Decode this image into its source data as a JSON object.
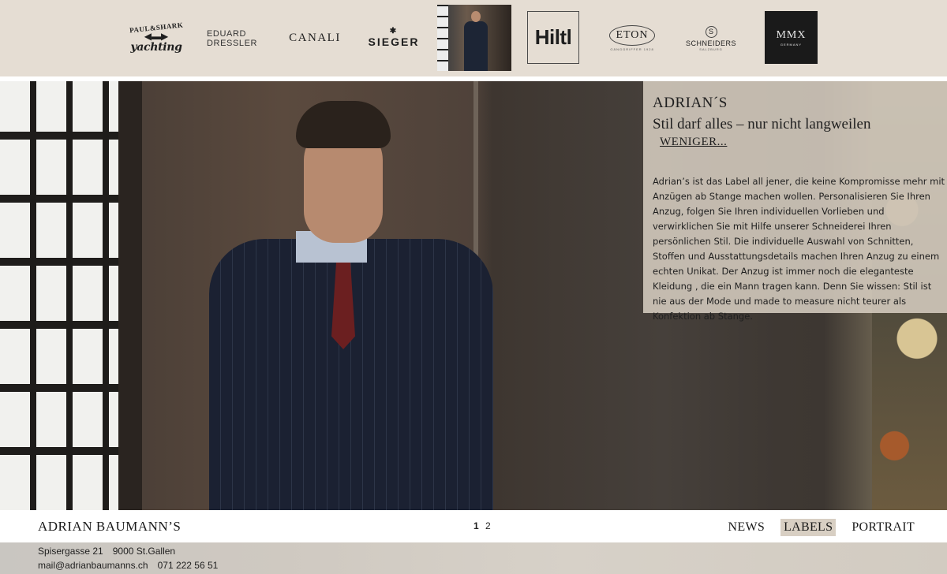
{
  "brands": {
    "paul_shark": {
      "top": "PAUL&SHARK",
      "bottom": "yachting"
    },
    "eduard_dressler": {
      "line1": "EDUARD",
      "line2": "DRESSLER"
    },
    "canali": "CANALI",
    "sieger": "SIEGER",
    "hiltl": "Hiltl",
    "eton": {
      "name": "ETON",
      "sub": "GÄNGGRIFFER 1928"
    },
    "schneiders": {
      "name": "SCHNEIDERS",
      "sub": "SALZBURG"
    },
    "mmx": {
      "name": "MMX",
      "sub": "GERMANY"
    }
  },
  "info": {
    "title": "ADRIAN´S",
    "tagline": "Stil darf alles – nur nicht langweilen",
    "toggle_label": "WENIGER...",
    "body": "Adrian’s ist das Label all jener, die keine Kompromisse mehr mit Anzügen ab Stange machen wollen. Personalisieren Sie Ihren Anzug, folgen Sie Ihren individuellen Vorlieben und verwirklichen Sie mit Hilfe unserer Schneiderei Ihren persönlichen Stil. Die individuelle Auswahl von Schnitten, Stoffen und Ausstattungsdetails machen Ihren Anzug zu einem echten Unikat. Der Anzug ist immer noch die eleganteste Kleidung , die ein Mann tragen kann. Denn Sie wissen: Stil ist nie aus der Mode und made to measure nicht teurer als Konfektion ab Stange."
  },
  "footer": {
    "logo": "ADRIAN BAUMANN’S",
    "pages": [
      "1",
      "2"
    ],
    "nav": [
      "NEWS",
      "LABELS",
      "PORTRAIT"
    ],
    "active_nav": "LABELS"
  },
  "contact": {
    "street": "Spisergasse 21",
    "city": "9000 St.Gallen",
    "email": "mail@adrianbaumanns.ch",
    "phone": "071 222 56 51"
  }
}
